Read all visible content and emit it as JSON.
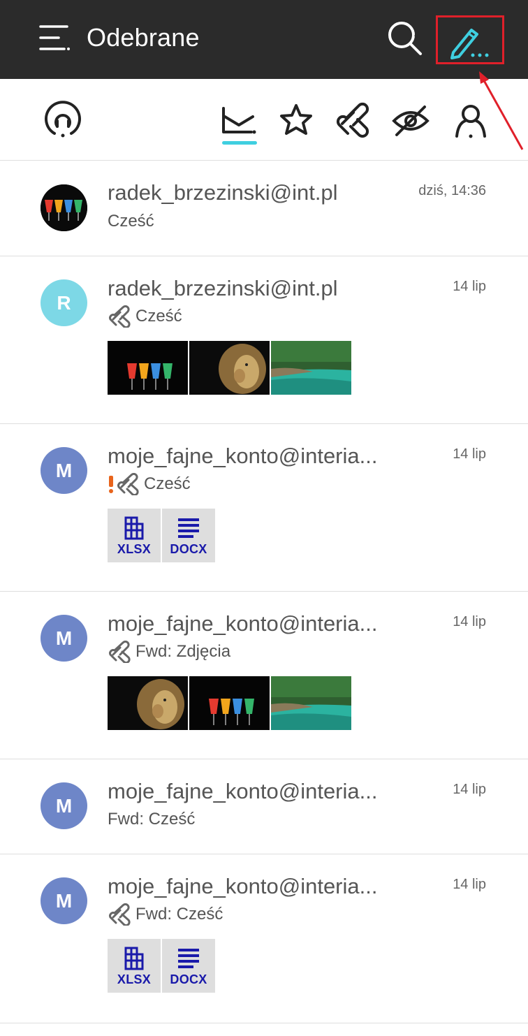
{
  "appbar": {
    "title": "Odebrane",
    "menu_icon": "hamburger-icon",
    "search_icon": "search-icon",
    "compose_icon": "compose-pen-icon",
    "highlight_color": "#e0202a"
  },
  "filters": [
    {
      "name": "filter-mailbox",
      "icon": "mailbox-circle-icon"
    },
    {
      "name": "filter-inbox",
      "icon": "inbox-tray-icon",
      "active": true
    },
    {
      "name": "filter-starred",
      "icon": "star-icon"
    },
    {
      "name": "filter-attachments",
      "icon": "paperclip-icon"
    },
    {
      "name": "filter-unread",
      "icon": "eye-crossed-icon"
    },
    {
      "name": "filter-contacts",
      "icon": "person-icon"
    }
  ],
  "accent_color": "#3fcfe0",
  "messages": [
    {
      "sender": "radek_brzezinski@int.pl",
      "date": "dziś, 14:36",
      "subject": "Cześć",
      "avatar": {
        "type": "photo",
        "desc": "colored glasses"
      },
      "attachment": false,
      "important": false
    },
    {
      "sender": "radek_brzezinski@int.pl",
      "date": "14 lip",
      "subject": "Cześć",
      "avatar": {
        "type": "letter",
        "letter": "R",
        "color": "#7dd8e6"
      },
      "attachment": true,
      "important": false,
      "thumbs": [
        "glasses",
        "lion",
        "river"
      ]
    },
    {
      "sender": "moje_fajne_konto@interia...",
      "date": "14 lip",
      "subject": "Cześć",
      "avatar": {
        "type": "letter",
        "letter": "M",
        "color": "#6e86c8"
      },
      "attachment": true,
      "important": true,
      "files": [
        "XLSX",
        "DOCX"
      ]
    },
    {
      "sender": "moje_fajne_konto@interia...",
      "date": "14 lip",
      "subject": "Fwd: Zdjęcia",
      "avatar": {
        "type": "letter",
        "letter": "M",
        "color": "#6e86c8"
      },
      "attachment": true,
      "important": false,
      "thumbs": [
        "lion",
        "glasses",
        "river"
      ]
    },
    {
      "sender": "moje_fajne_konto@interia...",
      "date": "14 lip",
      "subject": "Fwd: Cześć",
      "avatar": {
        "type": "letter",
        "letter": "M",
        "color": "#6e86c8"
      },
      "attachment": false,
      "important": false
    },
    {
      "sender": "moje_fajne_konto@interia...",
      "date": "14 lip",
      "subject": "Fwd: Cześć",
      "avatar": {
        "type": "letter",
        "letter": "M",
        "color": "#6e86c8"
      },
      "attachment": true,
      "important": false,
      "files": [
        "XLSX",
        "DOCX"
      ]
    }
  ]
}
